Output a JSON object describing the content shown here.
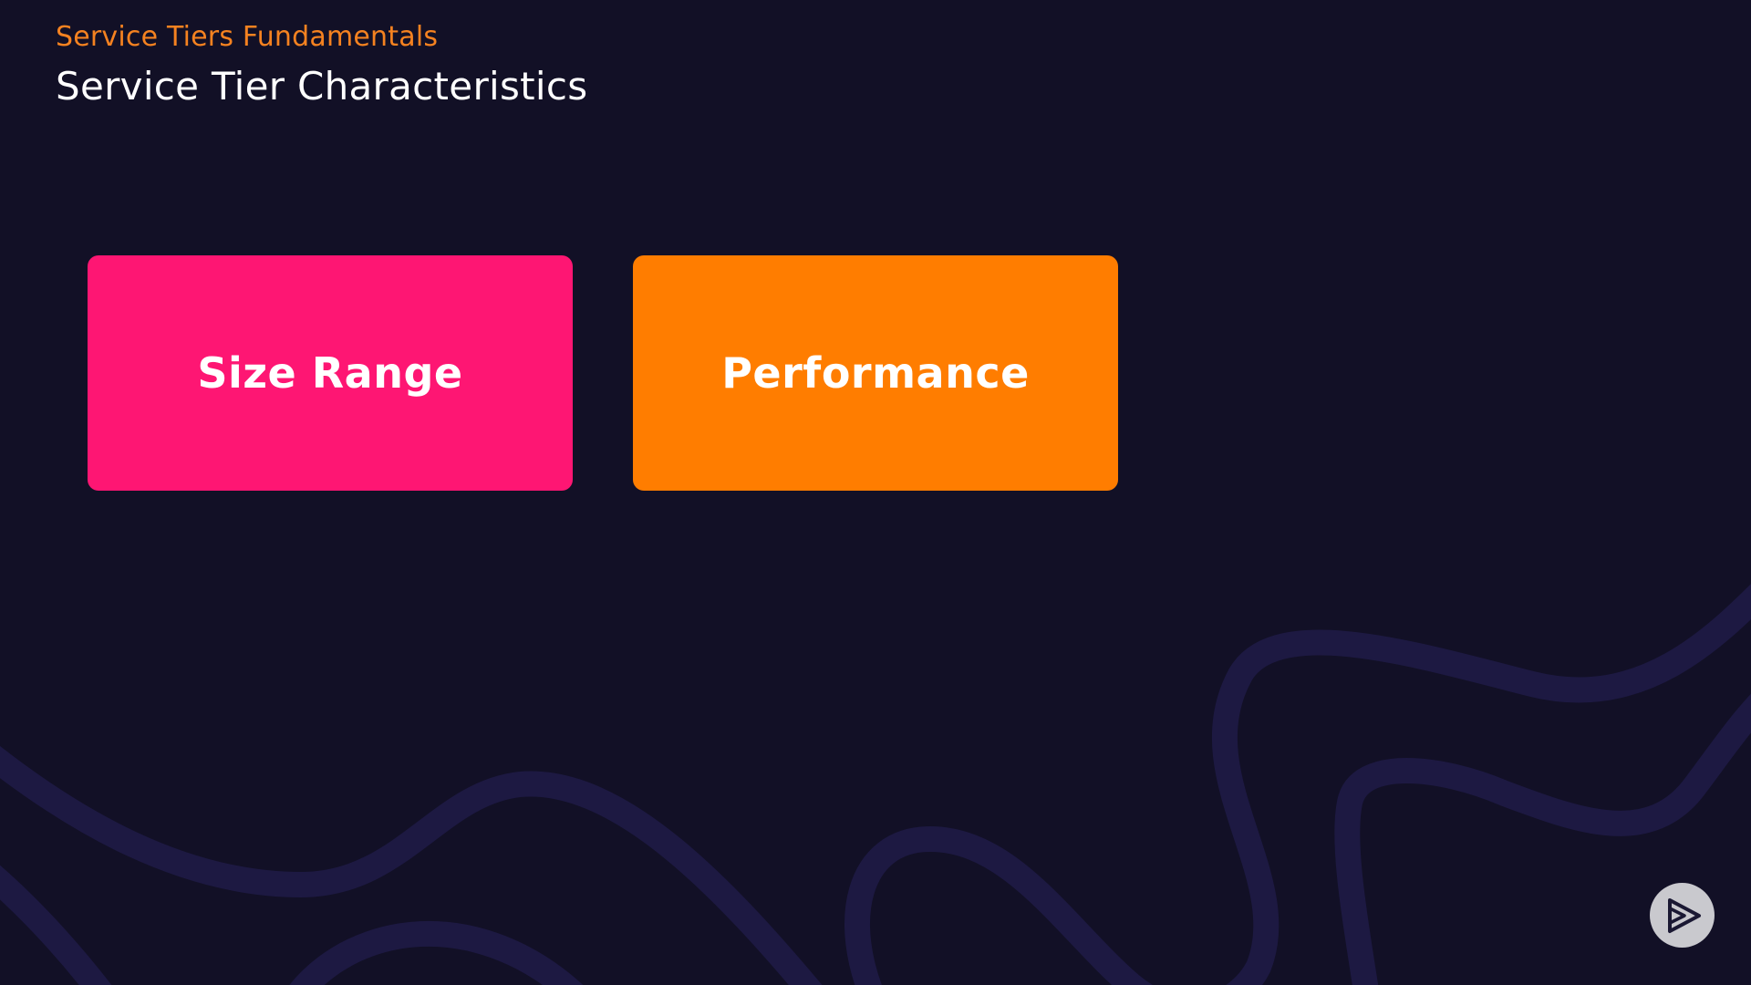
{
  "header": {
    "eyebrow": "Service Tiers Fundamentals",
    "title": "Service Tier Characteristics"
  },
  "cards": [
    {
      "label": "Size Range",
      "color": "#fe1673"
    },
    {
      "label": "Performance",
      "color": "#ff7d00"
    }
  ],
  "colors": {
    "background": "#121026",
    "accent": "#f58220",
    "wave": "#1d1942"
  },
  "icons": {
    "brand": "play-logo-icon"
  }
}
